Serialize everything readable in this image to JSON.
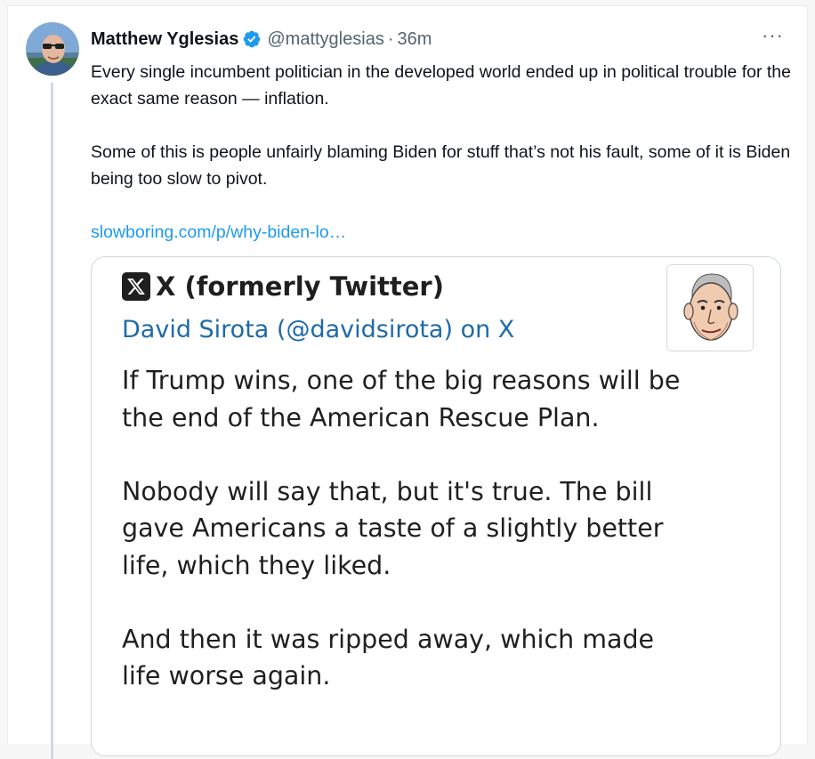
{
  "tweet": {
    "author_name": "Matthew Yglesias",
    "handle": "@mattyglesias",
    "separator": "·",
    "time": "36m",
    "more_label": "···",
    "paragraphs": [
      "Every single incumbent politician in the developed world ended up in political trouble for the exact same reason — inflation.",
      "Some of this is people unfairly blaming Biden for stuff that’s not his fault, some of it is Biden being too slow to pivot."
    ],
    "link_text": "slowboring.com/p/why-biden-lo…"
  },
  "card": {
    "site_name": "X (formerly Twitter)",
    "title": "David Sirota (@davidsirota) on X",
    "quote_paragraphs": [
      "If Trump wins, one of the big reasons will be the end of the American Rescue Plan.",
      "Nobody will say that, but it's true. The bill gave Americans a taste of a slightly better life, which they liked.",
      "And then it was ripped away, which made life worse again."
    ]
  },
  "colors": {
    "link": "#1d9bf0",
    "verified": "#1d9bf0",
    "card_title": "#1e6aa8",
    "secondary_text": "#536471",
    "thread_line": "#cfd9de"
  },
  "icons": {
    "verified": "verified-badge-icon",
    "more": "more-options-icon",
    "site_logo": "x-logo-icon"
  }
}
